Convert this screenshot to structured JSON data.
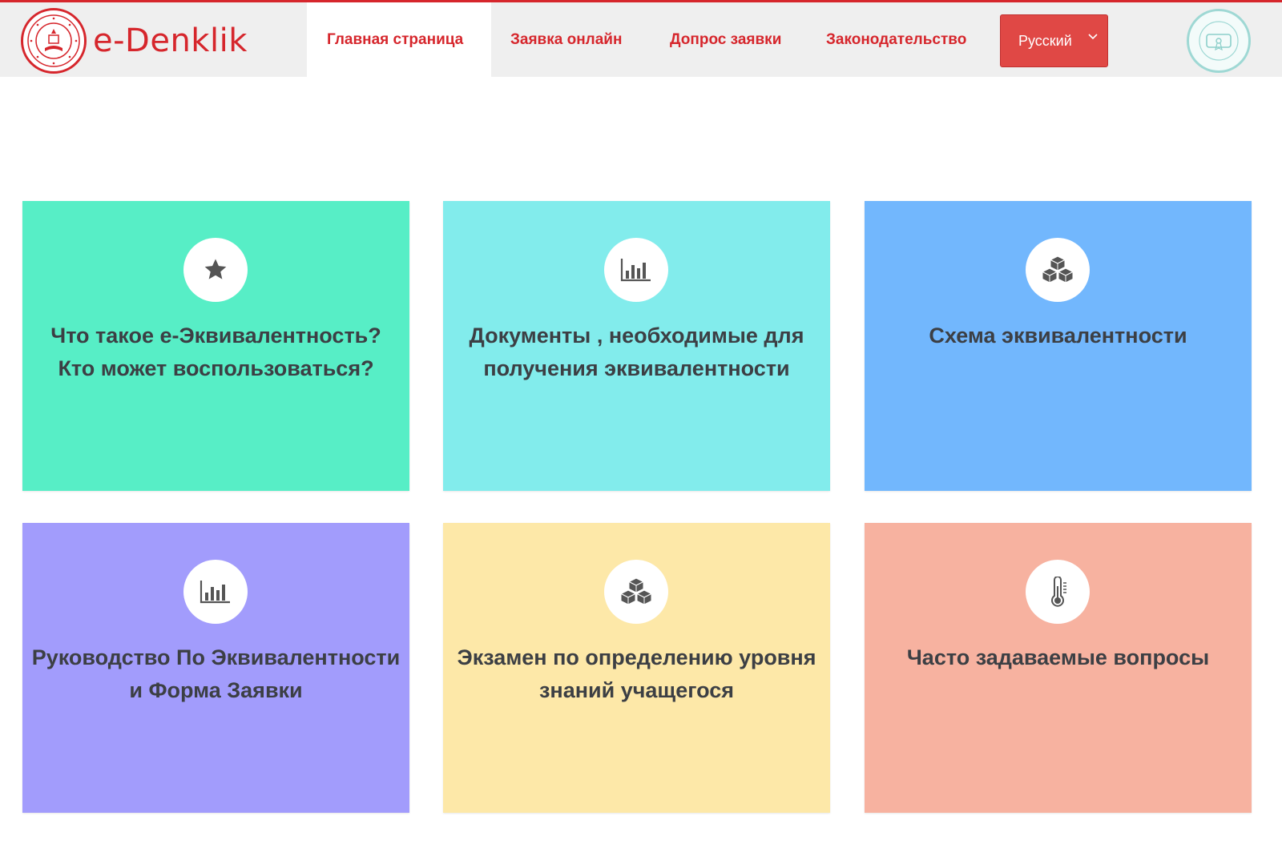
{
  "header": {
    "brand": "e-Denklik",
    "nav": [
      {
        "label": "Главная страница",
        "active": true
      },
      {
        "label": "Заявка онлайн",
        "active": false
      },
      {
        "label": "Допрос заявки",
        "active": false
      },
      {
        "label": "Законодательство",
        "active": false
      }
    ],
    "language": {
      "selected": "Русский"
    }
  },
  "cards": [
    {
      "title": "Что такое e-Эквивалентность? Кто может воспользоваться?",
      "icon": "star-icon",
      "color": "#57eec6"
    },
    {
      "title": "Документы , необходимые для получения эквивалентности",
      "icon": "bar-chart-icon",
      "color": "#82ecec"
    },
    {
      "title": "Схема эквивалентности",
      "icon": "cubes-icon",
      "color": "#72b7fd"
    },
    {
      "title": "Руководство По Эквивалентности и Форма Заявки",
      "icon": "bar-chart-icon",
      "color": "#a29cfc"
    },
    {
      "title": "Экзамен по определению уровня знаний учащегося",
      "icon": "cubes-icon",
      "color": "#fde8a8"
    },
    {
      "title": "Часто задаваемые вопросы",
      "icon": "thermometer-icon",
      "color": "#f7b2a0"
    }
  ],
  "colors": {
    "accent": "#d6262c",
    "language_button": "#e04845",
    "text": "#3c3f44",
    "icon": "#555555"
  }
}
